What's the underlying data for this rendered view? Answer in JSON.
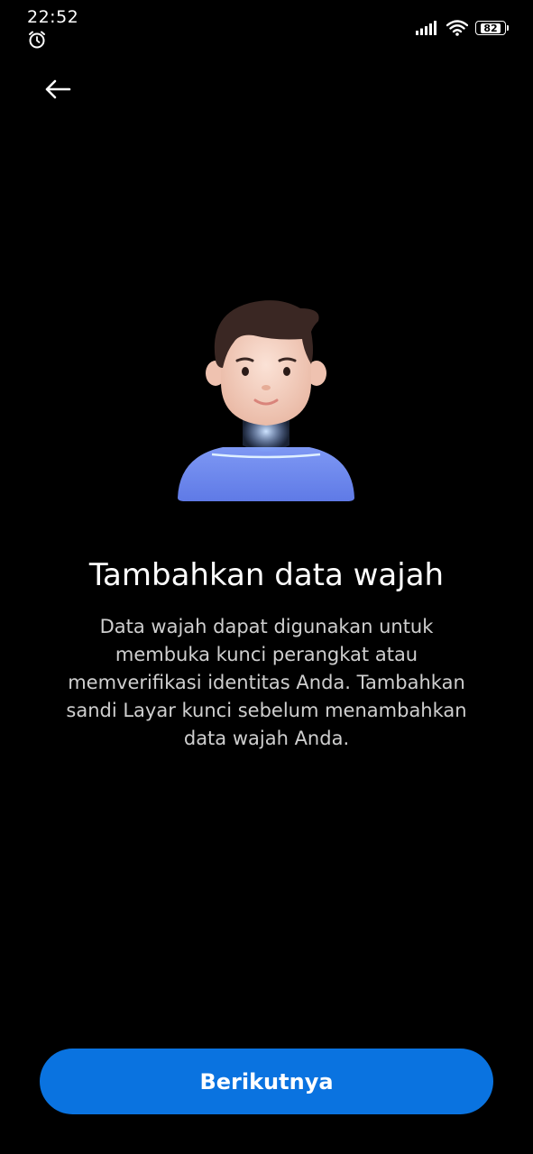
{
  "status_bar": {
    "time": "22:52",
    "battery_level": "82",
    "icons": [
      "alarm-icon",
      "signal-icon",
      "wifi-icon",
      "battery-icon"
    ]
  },
  "header": {
    "back_icon": "arrow-left-icon"
  },
  "illustration": {
    "icon": "face-avatar-illustration"
  },
  "main": {
    "title": "Tambahkan data wajah",
    "description": "Data wajah dapat digunakan untuk membuka kunci perangkat atau memverifikasi identitas Anda. Tambahkan sandi Layar kunci sebelum menambahkan data wajah Anda."
  },
  "footer": {
    "next_label": "Berikutnya"
  },
  "colors": {
    "background": "#000000",
    "accent": "#0a73e0",
    "shirt": "#6f8cf0"
  }
}
